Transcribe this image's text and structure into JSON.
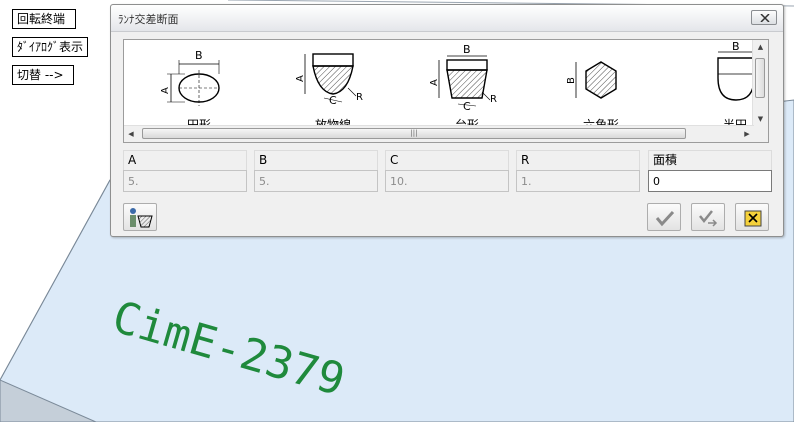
{
  "sidebar": {
    "end_label": "回転終端",
    "dialog_label": "ﾀﾞｲｱﾛｸﾞ表示",
    "switch_label": "切替 -->"
  },
  "dialog": {
    "title": "ﾗﾝﾅ交差断面",
    "shapes": [
      {
        "label": "円形",
        "dims": [
          "A",
          "B"
        ]
      },
      {
        "label": "放物線",
        "dims": [
          "A",
          "C",
          "R"
        ]
      },
      {
        "label": "台形",
        "dims": [
          "B",
          "A",
          "C",
          "R"
        ]
      },
      {
        "label": "六角形",
        "dims": [
          "B"
        ]
      },
      {
        "label": "半円",
        "dims": [
          "B"
        ]
      }
    ],
    "params": [
      {
        "label": "A",
        "value": "5."
      },
      {
        "label": "B",
        "value": "5."
      },
      {
        "label": "C",
        "value": "10."
      },
      {
        "label": "R",
        "value": "1."
      },
      {
        "label": "面積",
        "value": "0"
      }
    ]
  },
  "viewport": {
    "annotation": "CimE-2379",
    "annotation_color": "#1f8a3c",
    "plane_color": "#dceaf8"
  },
  "icons": {
    "close": "close-icon",
    "ok": "checkmark-icon",
    "apply": "check-arrow-icon",
    "cancel": "cancel-icon",
    "shape_pick": "shape-pick-icon"
  }
}
